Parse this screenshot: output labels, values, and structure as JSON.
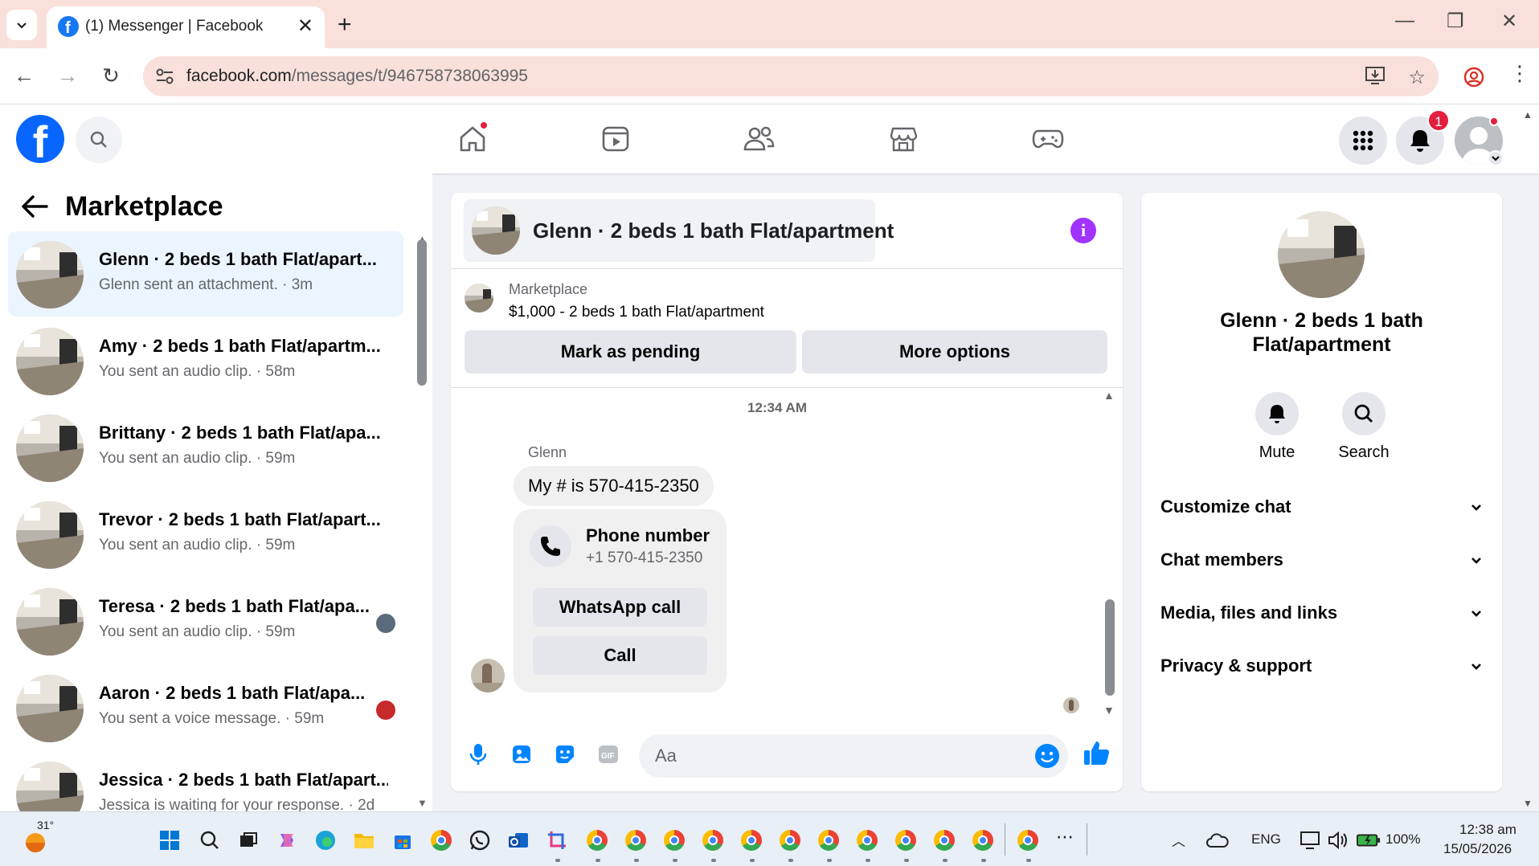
{
  "browser": {
    "tab_title": "(1) Messenger | Facebook",
    "url_host": "facebook.com",
    "url_path": "/messages/t/946758738063995"
  },
  "fb_header": {
    "notifications_count": "1"
  },
  "left_panel": {
    "title": "Marketplace",
    "conversations": [
      {
        "name": "Glenn · 2 beds 1 bath Flat/apart...",
        "preview": "Glenn sent an attachment. · 3m",
        "active": true
      },
      {
        "name": "Amy · 2 beds 1 bath Flat/apartm...",
        "preview": "You sent an audio clip. · 58m"
      },
      {
        "name": "Brittany · 2 beds 1 bath Flat/apa...",
        "preview": "You sent an audio clip. · 59m"
      },
      {
        "name": "Trevor · 2 beds 1 bath Flat/apart...",
        "preview": "You sent an audio clip. · 59m"
      },
      {
        "name": "Teresa · 2 beds 1 bath Flat/apa...",
        "preview": "You sent an audio clip. · 59m"
      },
      {
        "name": "Aaron · 2 beds 1 bath Flat/apa...",
        "preview": "You sent a voice message. · 59m"
      },
      {
        "name": "Jessica · 2 beds 1 bath Flat/apart...",
        "preview": "Jessica is waiting for your response. · 2d"
      }
    ]
  },
  "chat": {
    "header_title": "Glenn · 2 beds 1 bath Flat/apartment",
    "listing_label": "Marketplace",
    "listing_price": "$1,000 - 2 beds 1 bath Flat/apartment",
    "mark_pending_label": "Mark as pending",
    "more_options_label": "More options",
    "timestamp": "12:34 AM",
    "sender_name": "Glenn",
    "message_text": "My # is 570-415-2350",
    "phone_card_title": "Phone number",
    "phone_card_number": "+1 570-415-2350",
    "whatsapp_call_label": "WhatsApp call",
    "call_label": "Call",
    "composer_placeholder": "Aa"
  },
  "right_panel": {
    "name_line1": "Glenn · 2 beds 1 bath",
    "name_line2": "Flat/apartment",
    "mute_label": "Mute",
    "search_label": "Search",
    "sections": [
      "Customize chat",
      "Chat members",
      "Media, files and links",
      "Privacy & support"
    ]
  },
  "taskbar": {
    "weather_temp": "31°",
    "language": "ENG",
    "battery": "100%",
    "time": "12:38 am",
    "date": "15/05/2026"
  },
  "colors": {
    "fb_blue": "#0866ff",
    "messenger_blue": "#0084ff",
    "active_row": "#ebf5ff",
    "info_purple": "#a033ff",
    "notification_red": "#e41e3f"
  }
}
